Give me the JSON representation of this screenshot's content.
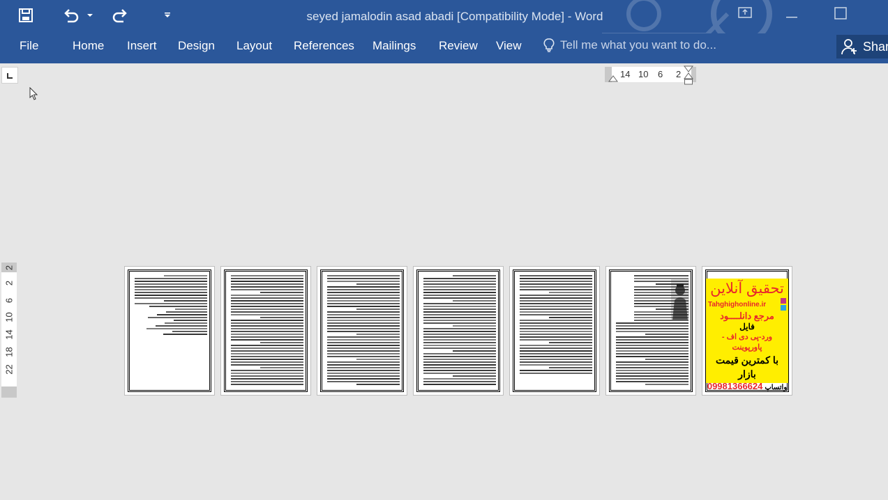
{
  "window": {
    "title": "seyed jamalodin asad abadi [Compatibility Mode] - Word"
  },
  "qat": {
    "save_icon": "save-icon",
    "undo_icon": "undo-icon",
    "redo_icon": "redo-icon",
    "customize_icon": "customize-qat-icon"
  },
  "ribbon": {
    "tabs": [
      "File",
      "Home",
      "Insert",
      "Design",
      "Layout",
      "References",
      "Mailings",
      "Review",
      "View"
    ],
    "tell_me": "Tell me what you want to do...",
    "share": "Shar"
  },
  "rulers": {
    "horizontal": [
      "14",
      "10",
      "6",
      "2"
    ],
    "vertical": [
      "2",
      "2",
      "6",
      "10",
      "14",
      "18",
      "22"
    ]
  },
  "pages": [
    {
      "type": "text"
    },
    {
      "type": "text"
    },
    {
      "type": "text"
    },
    {
      "type": "text"
    },
    {
      "type": "text"
    },
    {
      "type": "text-with-portrait"
    },
    {
      "type": "advertisement"
    }
  ],
  "ad": {
    "headline": "تحقیق آنلاین",
    "site": "Tahghighonline.ir",
    "line1": "مرجع دانلــــود",
    "line2": "فایل",
    "line3": "ورد-پی دی اف - پاورپوینت",
    "line4": "با کمترین قیمت بازار",
    "phone": "09981366624",
    "whatsapp": "واتساپ",
    "background": "#ffee00",
    "text_color": "#e8262b"
  },
  "colors": {
    "ribbon": "#2b579a",
    "workspace": "#e6e6e6"
  }
}
